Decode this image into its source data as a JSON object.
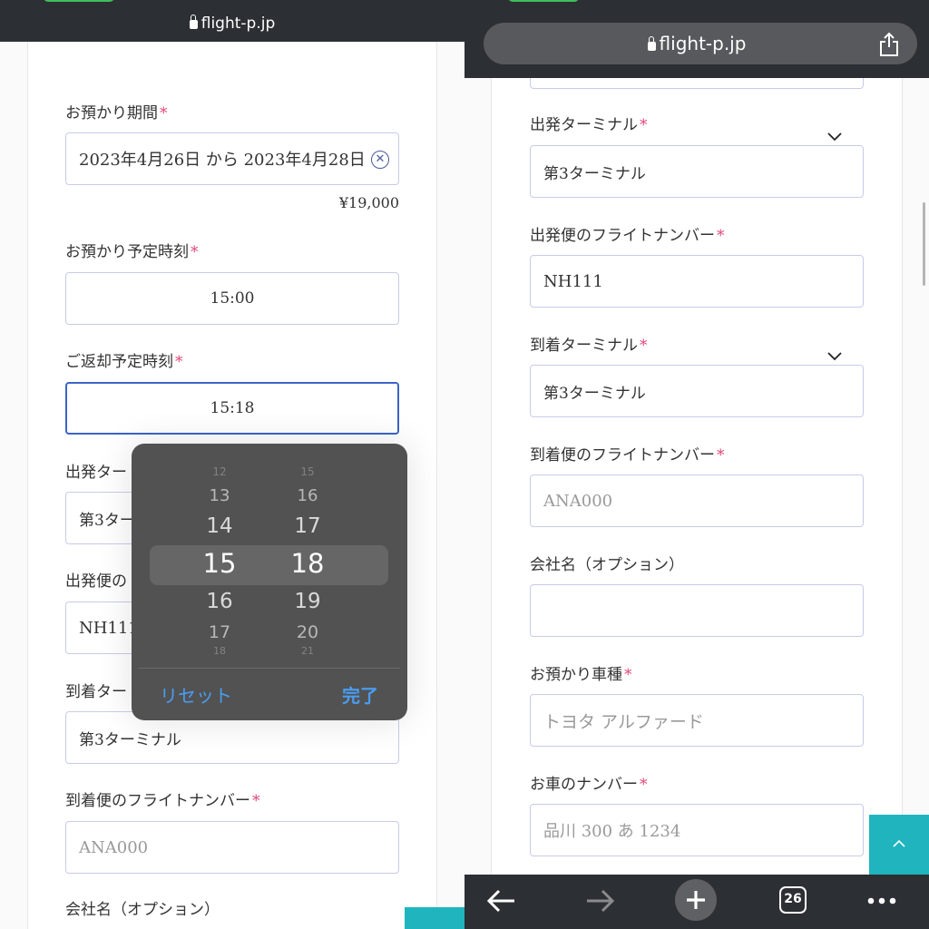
{
  "left": {
    "url": "flight-p.jp",
    "fields": {
      "period": {
        "label": "お預かり期間",
        "value": "2023年4月26日 から 2023年4月28日"
      },
      "price": "¥19,000",
      "drop_time": {
        "label": "お預かり予定時刻",
        "value": "15:00"
      },
      "return_time": {
        "label": "ご返却予定時刻",
        "value": "15:18"
      },
      "dep_terminal_label_partial": "出発ター",
      "dep_terminal_value_partial": "第3ター",
      "dep_flight_label_partial": "出発便の",
      "dep_flight_value_partial": "NH111",
      "arr_terminal_label_partial": "到着ター",
      "arr_terminal_value": "第3ターミナル",
      "arr_flight": {
        "label": "到着便のフライトナンバー",
        "placeholder": "ANA000"
      },
      "company_label": "会社名（オプション）"
    },
    "required_mark": "*",
    "picker": {
      "hours": [
        "12",
        "13",
        "14",
        "15",
        "16",
        "17",
        "18"
      ],
      "minutes": [
        "15",
        "16",
        "17",
        "18",
        "19",
        "20",
        "21"
      ],
      "selected_hour": "15",
      "selected_minute": "18",
      "reset_label": "リセット",
      "done_label": "完了"
    }
  },
  "right": {
    "url": "flight-p.jp",
    "fields": {
      "dep_terminal": {
        "label": "出発ターミナル",
        "value": "第3ターミナル"
      },
      "dep_flight": {
        "label": "出発便のフライトナンバー",
        "value": "NH111"
      },
      "arr_terminal": {
        "label": "到着ターミナル",
        "value": "第3ターミナル"
      },
      "arr_flight": {
        "label": "到着便のフライトナンバー",
        "placeholder": "ANA000"
      },
      "company": {
        "label": "会社名（オプション）",
        "value": ""
      },
      "car_model": {
        "label": "お預かり車種",
        "placeholder": "トヨタ アルファード"
      },
      "car_number": {
        "label": "お車のナンバー",
        "placeholder": "品川 300 あ 1234"
      }
    },
    "required_mark": "*",
    "toolbar": {
      "tab_count": "26"
    }
  },
  "colors": {
    "browser_bar": "#2c2f33",
    "required": "#e0467c",
    "field_border": "#c9cbe8",
    "focus_border": "#3d63c8",
    "picker_bg": "#525252",
    "picker_action": "#4a9cf0",
    "accent_teal": "#20b5be"
  },
  "icons": [
    "lock-icon",
    "share-icon",
    "clear-icon",
    "chevron-down-icon",
    "chevron-up-icon",
    "back-arrow-icon",
    "forward-arrow-icon",
    "plus-icon",
    "tabs-icon",
    "more-icon"
  ]
}
